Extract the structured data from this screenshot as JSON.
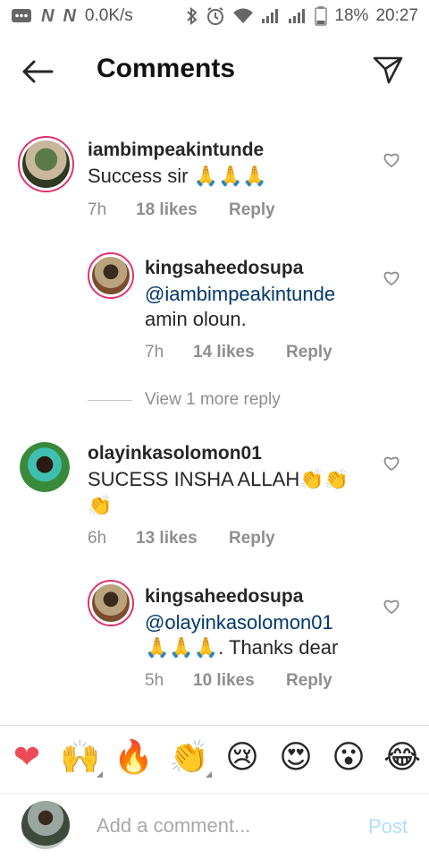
{
  "status_bar": {
    "speed": "0.0K/s",
    "battery": "18%",
    "time": "20:27",
    "n_label": "N"
  },
  "header": {
    "title": "Comments"
  },
  "comments": [
    {
      "username": "iambimpeakintunde",
      "text": "Success sir 🙏🙏🙏",
      "time": "7h",
      "likes": "18 likes",
      "reply_label": "Reply"
    },
    {
      "username": "kingsaheedosupa",
      "mention": "@iambimpeakintunde",
      "text": "amin oloun.",
      "time": "7h",
      "likes": "14 likes",
      "reply_label": "Reply"
    },
    {
      "username": "olayinkasolomon01",
      "text_line1": "SUCESS INSHA ALLAH👏👏",
      "text_line2": "👏",
      "time": "6h",
      "likes": "13 likes",
      "reply_label": "Reply"
    },
    {
      "username": "kingsaheedosupa",
      "mention": "@olayinkasolomon01",
      "text": "🙏🙏🙏. Thanks dear",
      "time": "5h",
      "likes": "10 likes",
      "reply_label": "Reply"
    }
  ],
  "view_more": "View 1 more reply",
  "emoji_bar": [
    "❤",
    "🙌",
    "🔥",
    "👏",
    "😢",
    "😍",
    "😮",
    "😂"
  ],
  "input": {
    "placeholder": "Add a comment...",
    "post_label": "Post"
  },
  "colors": {
    "mention": "#00376b",
    "post_disabled": "#b3dbff",
    "heart_emoji": "#ed4956"
  }
}
